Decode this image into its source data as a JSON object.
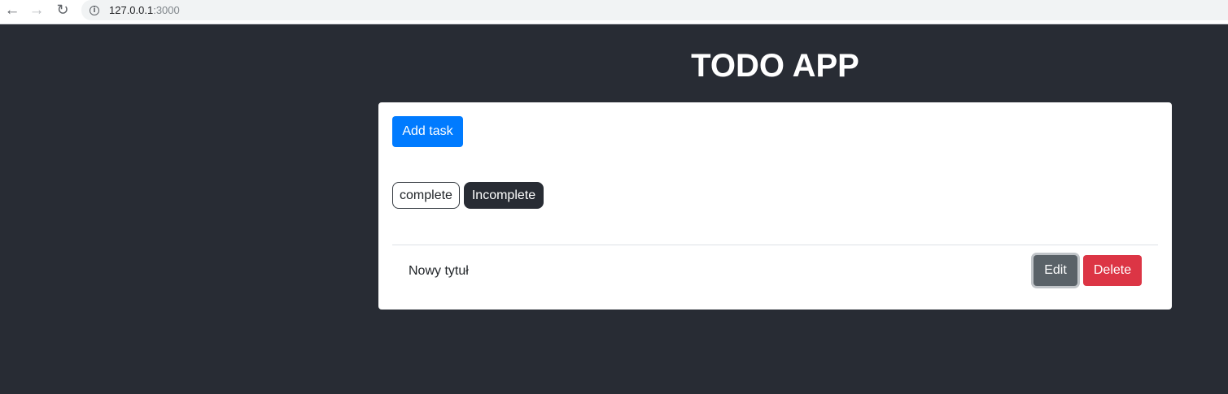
{
  "browser": {
    "url_host": "127.0.0.1",
    "url_port": ":3000",
    "icons": {
      "back": "back-arrow-icon",
      "forward": "forward-arrow-icon",
      "reload": "reload-icon",
      "info": "info-icon"
    }
  },
  "app": {
    "title": "TODO APP"
  },
  "toolbar": {
    "add_label": "Add task"
  },
  "filters": [
    {
      "label": "complete",
      "active": false
    },
    {
      "label": "Incomplete",
      "active": true
    }
  ],
  "tasks": [
    {
      "title": "Nowy tytuł",
      "edit_label": "Edit",
      "delete_label": "Delete"
    }
  ],
  "colors": {
    "background": "#282c34",
    "primary": "#007bff",
    "secondary": "#5a6268",
    "danger": "#dc3545",
    "dark": "#282c34"
  }
}
